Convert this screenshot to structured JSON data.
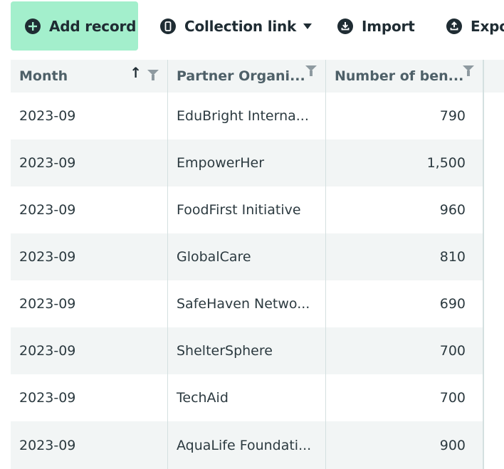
{
  "toolbar": {
    "add_label": "Add record",
    "collection_label": "Collection link",
    "import_label": "Import",
    "export_label": "Expo"
  },
  "table": {
    "columns": [
      "Month",
      "Partner Organi...",
      "Number of ben..."
    ],
    "rows": [
      {
        "month": "2023-09",
        "partner": "EduBright Interna...",
        "count": "790"
      },
      {
        "month": "2023-09",
        "partner": "EmpowerHer",
        "count": "1,500"
      },
      {
        "month": "2023-09",
        "partner": "FoodFirst Initiative",
        "count": "960"
      },
      {
        "month": "2023-09",
        "partner": "GlobalCare",
        "count": "810"
      },
      {
        "month": "2023-09",
        "partner": "SafeHaven Netwo...",
        "count": "690"
      },
      {
        "month": "2023-09",
        "partner": "ShelterSphere",
        "count": "700"
      },
      {
        "month": "2023-09",
        "partner": "TechAid",
        "count": "700"
      },
      {
        "month": "2023-09",
        "partner": "AquaLife Foundati...",
        "count": "900"
      }
    ]
  },
  "colors": {
    "add_button": "#a3efcc",
    "row_alt": "#f2f5f5",
    "header_bg": "#f2f5f5"
  }
}
